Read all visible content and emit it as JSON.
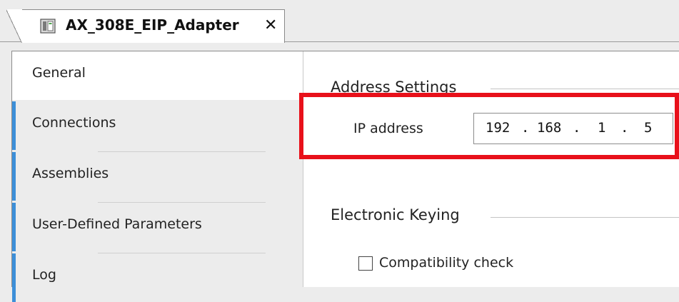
{
  "tab": {
    "title": "AX_308E_EIP_Adapter",
    "close_glyph": "✕",
    "icon": "device-icon"
  },
  "nav": {
    "items": [
      {
        "label": "General",
        "active": true
      },
      {
        "label": "Connections",
        "active": false
      },
      {
        "label": "Assemblies",
        "active": false
      },
      {
        "label": "User-Defined Parameters",
        "active": false
      },
      {
        "label": "Log",
        "active": false
      }
    ]
  },
  "address_settings": {
    "title": "Address Settings",
    "ip_label": "IP address",
    "ip_octets": [
      "192",
      "168",
      "1",
      "5"
    ]
  },
  "electronic_keying": {
    "title": "Electronic Keying",
    "compatibility_check_label": "Compatibility check",
    "compatibility_check_checked": false
  },
  "colors": {
    "accent_bar": "#3d8fd8",
    "highlight": "#e8101a"
  }
}
